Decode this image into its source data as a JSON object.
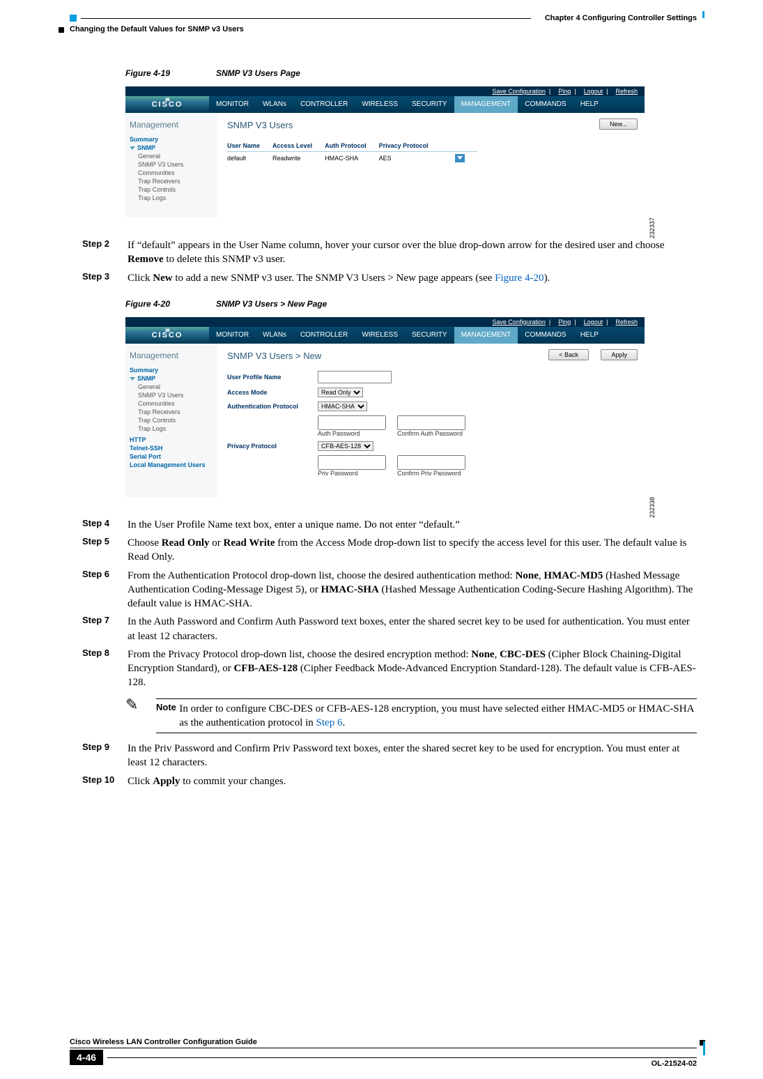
{
  "header": {
    "chapter": "Chapter 4      Configuring Controller Settings",
    "section": "Changing the Default Values for SNMP v3 Users"
  },
  "figures": {
    "f19": {
      "num": "Figure 4-19",
      "title": "SNMP V3 Users Page",
      "id": "232337"
    },
    "f20": {
      "num": "Figure 4-20",
      "title": "SNMP V3 Users > New Page",
      "id": "232338"
    }
  },
  "ss_common": {
    "save": "Save Configuration",
    "ping": "Ping",
    "logout": "Logout",
    "refresh": "Refresh",
    "logo": "CISCO",
    "menu": [
      "MONITOR",
      "WLANs",
      "CONTROLLER",
      "WIRELESS",
      "SECURITY",
      "MANAGEMENT",
      "COMMANDS",
      "HELP"
    ]
  },
  "ss1": {
    "side_title": "Management",
    "side": {
      "summary": "Summary",
      "snmp": "SNMP",
      "subs": [
        "General",
        "SNMP V3 Users",
        "Communities",
        "Trap Receivers",
        "Trap Controls",
        "Trap Logs"
      ]
    },
    "main_title": "SNMP V3 Users",
    "new_btn": "New...",
    "cols": [
      "User Name",
      "Access Level",
      "Auth Protocol",
      "Privacy Protocol"
    ],
    "row": [
      "default",
      "Readwrite",
      "HMAC-SHA",
      "AES"
    ]
  },
  "ss2": {
    "side_title": "Management",
    "side": {
      "summary": "Summary",
      "snmp": "SNMP",
      "subs": [
        "General",
        "SNMP V3 Users",
        "Communities",
        "Trap Receivers",
        "Trap Controls",
        "Trap Logs"
      ],
      "extra": [
        "HTTP",
        "Telnet-SSH",
        "Serial Port",
        "Local Management Users"
      ]
    },
    "main_title": "SNMP V3 Users > New",
    "back_btn": "< Back",
    "apply_btn": "Apply",
    "labels": {
      "upn": "User Profile Name",
      "am": "Access Mode",
      "ap": "Authentication Protocol",
      "pp": "Privacy Protocol",
      "authpw": "Auth Password",
      "cauthpw": "Confirm Auth Password",
      "privpw": "Priv Password",
      "cprivpw": "Confirm Priv Password"
    },
    "selects": {
      "am": "Read Only",
      "ap": "HMAC-SHA",
      "pp": "CFB-AES-128"
    }
  },
  "steps": {
    "s2": {
      "label": "Step 2",
      "p1": "If “default” appears in the User Name column, hover your cursor over the blue drop-down arrow for the desired user and choose ",
      "b1": "Remove",
      "p2": " to delete this SNMP v3 user."
    },
    "s3": {
      "label": "Step 3",
      "p1": "Click ",
      "b1": "New",
      "p2": " to add a new SNMP v3 user. The SNMP V3 Users > New page appears (see ",
      "l1": "Figure 4-20",
      "p3": ")."
    },
    "s4": {
      "label": "Step 4",
      "p1": "In the User Profile Name text box, enter a unique name. Do not enter “default.”"
    },
    "s5": {
      "label": "Step 5",
      "p1": "Choose ",
      "b1": "Read Only",
      "p2": " or ",
      "b2": "Read Write",
      "p3": " from the Access Mode drop-down list to specify the access level for this user. The default value is Read Only."
    },
    "s6": {
      "label": "Step 6",
      "p1": "From the Authentication Protocol drop-down list, choose the desired authentication method: ",
      "b1": "None",
      "p2": ", ",
      "b2": "HMAC-MD5",
      "p3": " (Hashed Message Authentication Coding-Message Digest 5), or ",
      "b3": "HMAC-SHA",
      "p4": " (Hashed Message Authentication Coding-Secure Hashing Algorithm). The default value is HMAC-SHA."
    },
    "s7": {
      "label": "Step 7",
      "p1": "In the Auth Password and Confirm Auth Password text boxes, enter the shared secret key to be used for authentication. You must enter at least 12 characters."
    },
    "s8": {
      "label": "Step 8",
      "p1": "From the Privacy Protocol drop-down list, choose the desired encryption method: ",
      "b1": "None",
      "p2": ", ",
      "b2": "CBC-DES",
      "p3": " (Cipher Block Chaining-Digital Encryption Standard), or ",
      "b3": "CFB-AES-128",
      "p4": " (Cipher Feedback Mode-Advanced Encryption Standard-128). The default value is CFB-AES-128."
    },
    "s9": {
      "label": "Step 9",
      "p1": "In the Priv Password and Confirm Priv Password text boxes, enter the shared secret key to be used for encryption. You must enter at least 12 characters."
    },
    "s10": {
      "label": "Step 10",
      "p1": "Click ",
      "b1": "Apply",
      "p2": " to commit your changes."
    }
  },
  "note": {
    "label": "Note",
    "p1": "In order to configure CBC-DES or CFB-AES-128 encryption, you must have selected either HMAC-MD5 or HMAC-SHA as the authentication protocol in ",
    "l1": "Step 6",
    "p2": "."
  },
  "footer": {
    "title": "Cisco Wireless LAN Controller Configuration Guide",
    "page": "4-46",
    "ol": "OL-21524-02"
  }
}
